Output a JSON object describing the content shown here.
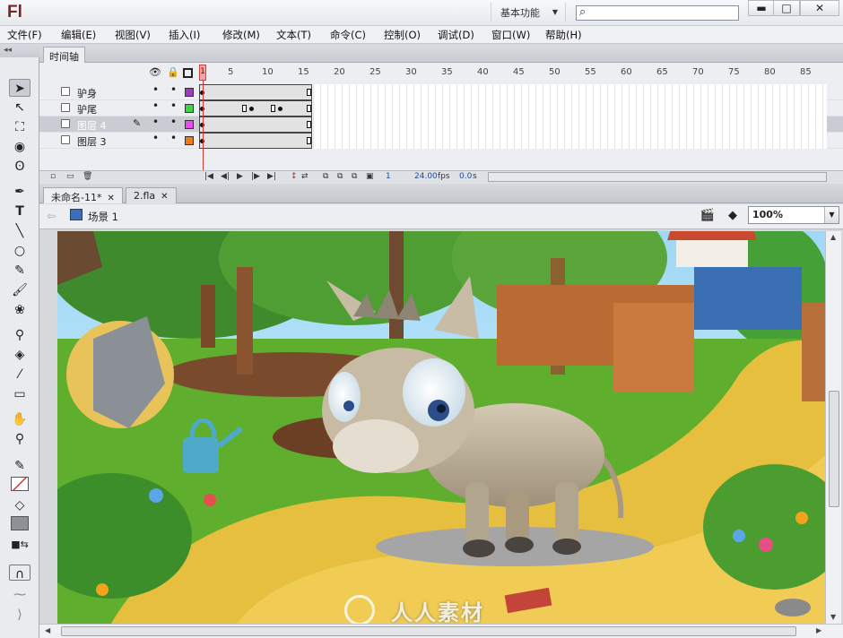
{
  "app": {
    "logo": "Fl",
    "workspace": "基本功能",
    "search_placeholder": ""
  },
  "window_buttons": {
    "min": "▬",
    "max": "□",
    "close": "✕"
  },
  "menus": [
    "文件(F)",
    "编辑(E)",
    "视图(V)",
    "插入(I)",
    "修改(M)",
    "文本(T)",
    "命令(C)",
    "控制(O)",
    "调试(D)",
    "窗口(W)",
    "帮助(H)"
  ],
  "timeline": {
    "tab": "时间轴",
    "ruler": [
      "1",
      "5",
      "10",
      "15",
      "20",
      "25",
      "30",
      "35",
      "40",
      "45",
      "50",
      "55",
      "60",
      "65",
      "70",
      "75",
      "80",
      "85"
    ],
    "layers": [
      {
        "name": "驴身",
        "color": "#9b3fbf",
        "active": false
      },
      {
        "name": "驴尾",
        "color": "#3fd24a",
        "active": false
      },
      {
        "name": "图层 4",
        "color": "#e84de8",
        "active": true
      },
      {
        "name": "图层 3",
        "color": "#f07b1a",
        "active": false
      }
    ],
    "footer": {
      "frame": "1",
      "fps": "24.00",
      "fps_unit": "fps",
      "time": "0.0",
      "time_unit": "s"
    }
  },
  "doc_tabs": [
    "未命名-11*",
    "2.fla"
  ],
  "editbar": {
    "scene": "场景 1",
    "zoom": "100%"
  },
  "watermark": "人人素材",
  "colors": {
    "sky": "#8ad0f0",
    "grass": "#4fa32a",
    "path": "#e8c040",
    "donkey": "#bfb29a"
  }
}
